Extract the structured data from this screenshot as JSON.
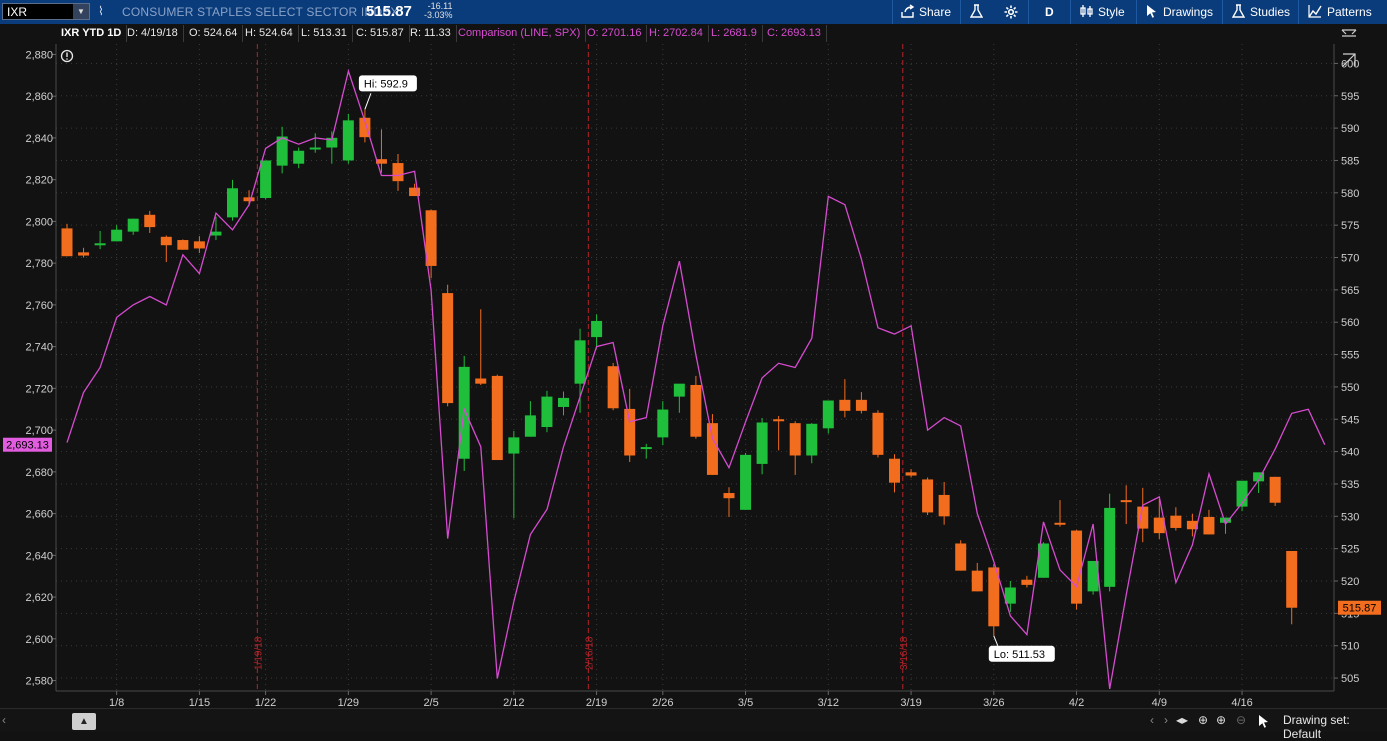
{
  "header": {
    "symbol": "IXR",
    "index_name": "CONSUMER STAPLES SELECT SECTOR INDEX",
    "last_price": "515.87",
    "change": "-16.11",
    "change_pct": "-3.03%",
    "buttons": {
      "share": "Share",
      "period": "D",
      "style": "Style",
      "drawings": "Drawings",
      "studies": "Studies",
      "patterns": "Patterns"
    }
  },
  "infobar": {
    "title": "IXR YTD 1D",
    "date": "D: 4/19/18",
    "open": "O: 524.64",
    "high": "H: 524.64",
    "low": "L: 513.31",
    "close": "C: 515.87",
    "range": "R: 11.33",
    "comparison": "Comparison (LINE, SPX)",
    "cmp_open": "O: 2701.16",
    "cmp_high": "H: 2702.84",
    "cmp_low": "L: 2681.9",
    "cmp_close": "C: 2693.13"
  },
  "chart_data": {
    "type": "candlestick",
    "symbol": "IXR",
    "comparison_symbol": "SPX",
    "right_axis_ticks": [
      505,
      510,
      515,
      520,
      525,
      530,
      535,
      540,
      545,
      550,
      555,
      560,
      565,
      570,
      575,
      580,
      585,
      590,
      595,
      600
    ],
    "left_axis_ticks": [
      2580,
      2600,
      2620,
      2640,
      2660,
      2680,
      2700,
      2720,
      2740,
      2760,
      2780,
      2800,
      2820,
      2840,
      2860,
      2880
    ],
    "left_axis_tick_labels": [
      "2,580",
      "2,600",
      "2,620",
      "2,640",
      "2,660",
      "2,680",
      "2,700",
      "2,720",
      "2,740",
      "2,760",
      "2,780",
      "2,800",
      "2,820",
      "2,840",
      "2,860",
      "2,880"
    ],
    "right_ylim": [
      503.0,
      603.0
    ],
    "left_ylim": [
      2575.0,
      2885.0
    ],
    "x_tick_labels": [
      {
        "label": "1/8",
        "day": 3
      },
      {
        "label": "1/15",
        "day": 8
      },
      {
        "label": "1/22",
        "day": 12
      },
      {
        "label": "1/29",
        "day": 17
      },
      {
        "label": "2/5",
        "day": 22
      },
      {
        "label": "2/12",
        "day": 27
      },
      {
        "label": "2/19",
        "day": 32
      },
      {
        "label": "2/26",
        "day": 36
      },
      {
        "label": "3/5",
        "day": 41
      },
      {
        "label": "3/12",
        "day": 46
      },
      {
        "label": "3/19",
        "day": 51
      },
      {
        "label": "3/26",
        "day": 56
      },
      {
        "label": "4/2",
        "day": 61
      },
      {
        "label": "4/9",
        "day": 66
      },
      {
        "label": "4/16",
        "day": 71
      }
    ],
    "vertical_markers": [
      {
        "label": "1/19/18",
        "day": 11.5
      },
      {
        "label": "2/16/18",
        "day": 31.5
      },
      {
        "label": "3/16/18",
        "day": 50.5
      }
    ],
    "candles": [
      {
        "o": 574.5,
        "h": 575.2,
        "l": 570.2,
        "c": 570.2
      },
      {
        "o": 570.8,
        "h": 571.5,
        "l": 570.0,
        "c": 570.3
      },
      {
        "o": 572.0,
        "h": 574.1,
        "l": 571.3,
        "c": 572.2
      },
      {
        "o": 572.5,
        "h": 575.0,
        "l": 572.5,
        "c": 574.3
      },
      {
        "o": 574.0,
        "h": 576.0,
        "l": 573.5,
        "c": 576.0
      },
      {
        "o": 576.6,
        "h": 577.2,
        "l": 573.8,
        "c": 574.7
      },
      {
        "o": 573.2,
        "h": 573.4,
        "l": 569.3,
        "c": 571.9
      },
      {
        "o": 572.7,
        "h": 572.8,
        "l": 571.2,
        "c": 571.2
      },
      {
        "o": 572.5,
        "h": 573.3,
        "l": 570.7,
        "c": 571.4
      },
      {
        "o": 573.4,
        "h": 576.3,
        "l": 572.7,
        "c": 574.0
      },
      {
        "o": 576.2,
        "h": 582.0,
        "l": 575.7,
        "c": 580.7
      },
      {
        "o": 579.3,
        "h": 580.4,
        "l": 578.0,
        "c": 578.7
      },
      {
        "o": 579.2,
        "h": 585.0,
        "l": 579.0,
        "c": 585.0
      },
      {
        "o": 584.2,
        "h": 590.2,
        "l": 583.0,
        "c": 588.7
      },
      {
        "o": 584.5,
        "h": 587.0,
        "l": 583.8,
        "c": 586.5
      },
      {
        "o": 587.0,
        "h": 589.2,
        "l": 586.2,
        "c": 587.0
      },
      {
        "o": 587.0,
        "h": 589.5,
        "l": 584.5,
        "c": 588.5
      },
      {
        "o": 585.0,
        "h": 592.2,
        "l": 584.5,
        "c": 591.2
      },
      {
        "o": 591.6,
        "h": 592.9,
        "l": 587.8,
        "c": 588.6
      },
      {
        "o": 585.2,
        "h": 589.8,
        "l": 583.1,
        "c": 584.5
      },
      {
        "o": 584.6,
        "h": 586.0,
        "l": 580.3,
        "c": 581.8
      },
      {
        "o": 580.8,
        "h": 581.4,
        "l": 579.5,
        "c": 579.5
      },
      {
        "o": 577.3,
        "h": 577.4,
        "l": 566.8,
        "c": 568.7
      },
      {
        "o": 564.5,
        "h": 565.8,
        "l": 547.0,
        "c": 547.5
      },
      {
        "o": 538.9,
        "h": 554.8,
        "l": 537.0,
        "c": 553.1
      },
      {
        "o": 551.3,
        "h": 562.0,
        "l": 550.3,
        "c": 550.5
      },
      {
        "o": 551.7,
        "h": 551.9,
        "l": 538.7,
        "c": 538.7
      },
      {
        "o": 539.7,
        "h": 543.2,
        "l": 529.7,
        "c": 542.2
      },
      {
        "o": 542.3,
        "h": 547.8,
        "l": 542.3,
        "c": 545.6
      },
      {
        "o": 543.8,
        "h": 549.4,
        "l": 543.0,
        "c": 548.5
      },
      {
        "o": 546.9,
        "h": 549.3,
        "l": 545.6,
        "c": 548.3
      },
      {
        "o": 550.5,
        "h": 559.0,
        "l": 546.0,
        "c": 557.2
      },
      {
        "o": 557.7,
        "h": 561.2,
        "l": 555.9,
        "c": 560.2
      },
      {
        "o": 553.2,
        "h": 553.7,
        "l": 546.4,
        "c": 546.7
      },
      {
        "o": 546.6,
        "h": 549.7,
        "l": 538.4,
        "c": 539.4
      },
      {
        "o": 540.7,
        "h": 541.2,
        "l": 538.9,
        "c": 540.7
      },
      {
        "o": 542.2,
        "h": 547.8,
        "l": 541.0,
        "c": 546.5
      },
      {
        "o": 548.5,
        "h": 550.2,
        "l": 546.0,
        "c": 550.5
      },
      {
        "o": 550.3,
        "h": 551.7,
        "l": 542.0,
        "c": 542.3
      },
      {
        "o": 544.4,
        "h": 545.8,
        "l": 536.4,
        "c": 536.4
      },
      {
        "o": 533.6,
        "h": 534.5,
        "l": 529.9,
        "c": 532.8
      },
      {
        "o": 531.0,
        "h": 539.8,
        "l": 531.0,
        "c": 539.5
      },
      {
        "o": 538.1,
        "h": 545.2,
        "l": 536.5,
        "c": 544.5
      },
      {
        "o": 545.0,
        "h": 545.5,
        "l": 540.2,
        "c": 544.8
      },
      {
        "o": 544.4,
        "h": 544.7,
        "l": 536.4,
        "c": 539.4
      },
      {
        "o": 539.4,
        "h": 544.4,
        "l": 538.2,
        "c": 544.3
      },
      {
        "o": 543.6,
        "h": 547.9,
        "l": 542.8,
        "c": 547.9
      },
      {
        "o": 548.0,
        "h": 551.2,
        "l": 545.3,
        "c": 546.3
      },
      {
        "o": 548.0,
        "h": 549.2,
        "l": 545.9,
        "c": 546.3
      },
      {
        "o": 546.0,
        "h": 546.4,
        "l": 539.1,
        "c": 539.5
      },
      {
        "o": 538.9,
        "h": 539.6,
        "l": 533.7,
        "c": 535.2
      },
      {
        "o": 536.8,
        "h": 537.3,
        "l": 536.0,
        "c": 536.3
      },
      {
        "o": 535.7,
        "h": 536.0,
        "l": 530.2,
        "c": 530.6
      },
      {
        "o": 533.3,
        "h": 535.3,
        "l": 528.7,
        "c": 530.0
      },
      {
        "o": 525.8,
        "h": 526.3,
        "l": 521.6,
        "c": 521.6
      },
      {
        "o": 521.6,
        "h": 522.8,
        "l": 518.4,
        "c": 518.4
      },
      {
        "o": 522.1,
        "h": 522.6,
        "l": 511.53,
        "c": 513.0
      },
      {
        "o": 516.5,
        "h": 520.0,
        "l": 515.2,
        "c": 519.0
      },
      {
        "o": 520.2,
        "h": 520.8,
        "l": 519.0,
        "c": 519.4
      },
      {
        "o": 520.5,
        "h": 526.0,
        "l": 520.5,
        "c": 525.8
      },
      {
        "o": 529.0,
        "h": 532.5,
        "l": 528.4,
        "c": 528.7
      },
      {
        "o": 527.8,
        "h": 527.9,
        "l": 515.6,
        "c": 516.5
      },
      {
        "o": 518.4,
        "h": 523.1,
        "l": 517.9,
        "c": 523.1
      },
      {
        "o": 519.1,
        "h": 533.5,
        "l": 518.4,
        "c": 531.3
      },
      {
        "o": 532.5,
        "h": 534.8,
        "l": 528.8,
        "c": 532.3
      },
      {
        "o": 531.5,
        "h": 534.4,
        "l": 526.0,
        "c": 528.1
      },
      {
        "o": 529.8,
        "h": 532.7,
        "l": 526.5,
        "c": 527.4
      },
      {
        "o": 530.1,
        "h": 531.4,
        "l": 527.8,
        "c": 528.2
      },
      {
        "o": 529.3,
        "h": 530.4,
        "l": 526.9,
        "c": 528.0
      },
      {
        "o": 529.9,
        "h": 531.0,
        "l": 527.2,
        "c": 527.2
      },
      {
        "o": 529.0,
        "h": 529.8,
        "l": 527.3,
        "c": 529.8
      },
      {
        "o": 531.5,
        "h": 535.0,
        "l": 530.8,
        "c": 535.5
      },
      {
        "o": 535.4,
        "h": 536.2,
        "l": 533.6,
        "c": 536.8
      },
      {
        "o": 536.1,
        "h": 536.1,
        "l": 531.6,
        "c": 532.1
      },
      {
        "o": 524.64,
        "h": 524.64,
        "l": 513.31,
        "c": 515.87
      }
    ],
    "comparison_line": [
      2694,
      2718,
      2730,
      2754,
      2760,
      2764,
      2760,
      2784,
      2775,
      2804,
      2796,
      2808,
      2835,
      2840,
      2837,
      2840,
      2839,
      2872,
      2848,
      2822,
      2822,
      2824,
      2767,
      2648,
      2710,
      2692,
      2581,
      2618,
      2650,
      2662,
      2692,
      2716,
      2740,
      2742,
      2704,
      2706,
      2750,
      2781,
      2736,
      2696,
      2682,
      2704,
      2725,
      2732,
      2730,
      2744,
      2812,
      2808,
      2782,
      2749,
      2746,
      2750,
      2700,
      2706,
      2702,
      2660,
      2637,
      2611,
      2602,
      2656,
      2633,
      2625,
      2655,
      2576,
      2621,
      2664,
      2668,
      2627,
      2645,
      2679,
      2655,
      2665,
      2676,
      2691,
      2708,
      2710,
      2693
    ],
    "hi_label": "Hi: 592.9",
    "lo_label": "Lo: 511.53",
    "left_price_badge": "2,693.13",
    "right_price_badge": "515.87",
    "colors": {
      "up": "#1fbf3c",
      "down": "#f26d1e",
      "comparison": "#d64bd0",
      "marker": "#b8242a",
      "grid": "#3a3a3a"
    }
  },
  "bottombar": {
    "drawing_set": "Drawing set: Default"
  }
}
